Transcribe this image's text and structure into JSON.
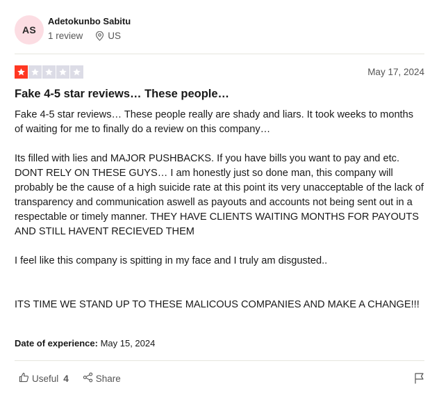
{
  "reviewer": {
    "initials": "AS",
    "name": "Adetokunbo Sabitu",
    "review_count": "1 review",
    "country": "US"
  },
  "review": {
    "rating": 1,
    "max_rating": 5,
    "date": "May 17, 2024",
    "title": "Fake 4-5 star reviews… These people…",
    "paragraphs": [
      "Fake 4-5 star reviews… These people really are shady and liars. It took weeks to months of waiting for me to finally do a review on this company…",
      "Its filled with lies and MAJOR PUSHBACKS. If you have bills you want to pay and etc. DONT RELY ON THESE GUYS… I am honestly just so done man, this company will probably be the cause of a high suicide rate at this point its very unacceptable of the lack of transparency and communication aswell as payouts and accounts not being sent out in a respectable or timely manner. THEY HAVE CLIENTS WAITING MONTHS FOR PAYOUTS AND STILL HAVENT RECIEVED THEM",
      "I feel like this company is spitting in my face and I truly am disgusted..",
      "ITS TIME WE STAND UP TO THESE MALICOUS COMPANIES AND MAKE A CHANGE!!!"
    ],
    "experience_label": "Date of experience:",
    "experience_date": "May 15, 2024"
  },
  "actions": {
    "useful_label": "Useful",
    "useful_count": "4",
    "share_label": "Share"
  },
  "colors": {
    "star_active": "#ff3722",
    "star_inactive": "#dcdce6",
    "avatar_bg": "#fcdde3"
  },
  "icons": [
    "location-pin-icon",
    "star-icon",
    "thumbs-up-icon",
    "share-icon",
    "flag-icon"
  ]
}
